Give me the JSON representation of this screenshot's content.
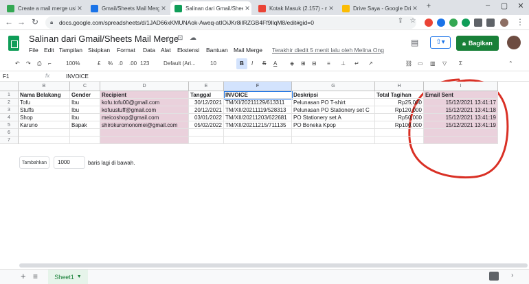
{
  "browser": {
    "tabs": [
      {
        "title": "Create a mail merge using",
        "color": "#34a853"
      },
      {
        "title": "Gmail/Sheets Mail Merge",
        "color": "#1a73e8"
      },
      {
        "title": "Salinan dari Gmail/Sheets",
        "color": "#0f9d58"
      },
      {
        "title": "Kotak Masuk (2.157) - me",
        "color": "#ea4335"
      },
      {
        "title": "Drive Saya - Google Drive",
        "color": "#fbbc04"
      }
    ],
    "new_tab": "+",
    "url": "docs.google.com/spreadsheets/d/1JAD66xKMUNAok-Aweq-atIOiJKr8iIRZGB4Ff9IlqM8/edit#gid=0"
  },
  "sheet": {
    "title": "Salinan dari Gmail/Sheets Mail Merge",
    "menus": [
      "File",
      "Edit",
      "Tampilan",
      "Sisipkan",
      "Format",
      "Data",
      "Alat",
      "Ekstensi",
      "Bantuan",
      "Mail Merge"
    ],
    "last_edit": "Terakhir diedit 5 menit lalu oleh Melina Ong",
    "share_label": "Bagikan",
    "share_color": "#188038"
  },
  "toolbar": {
    "zoom": "100%",
    "currency": "£",
    "percent": "%",
    "decimal_down": ".0",
    "decimal_up": ".00",
    "more_formats": "123",
    "font": "Default (Ari...",
    "font_size": "10",
    "bold": "B",
    "italic": "I",
    "strike": "S",
    "text_color": "A"
  },
  "formula_bar": {
    "cell_ref": "F1",
    "fx": "fx",
    "value": "INVOICE"
  },
  "columns": [
    "B",
    "C",
    "D",
    "E",
    "F",
    "G",
    "H",
    "I"
  ],
  "rows": [
    "1",
    "2",
    "3",
    "4",
    "5",
    "6",
    "7"
  ],
  "headers": [
    "Nama Belakang",
    "Gender",
    "Recipient",
    "Tanggal",
    "INVOICE",
    "Deskripsi",
    "Total Tagihan",
    "Email Sent"
  ],
  "data": [
    [
      "Tofu",
      "Ibu",
      "kofu.tofu00@gmail.com",
      "30/12/2021",
      "TM/XI/20211129/613311",
      "Pelunasan PO T-shirt",
      "Rp25,000",
      "15/12/2021 13:41:17"
    ],
    [
      "Stuffs",
      "Ibu",
      "kofuustuff@gmail.com",
      "20/12/2021",
      "TM/XII/20211119/528313",
      "Pelunasan PO Stationery set C",
      "Rp120,000",
      "15/12/2021 13:41:18"
    ],
    [
      "Shop",
      "Ibu",
      "meicoshop@gmail.com",
      "03/01/2022",
      "TM/XII/20211203/622681",
      "PO Stationery set A",
      "Rp50,000",
      "15/12/2021 13:41:19"
    ],
    [
      "Karuno",
      "Bapak",
      "shirokuromonomei@gmail.com",
      "05/02/2022",
      "TM/XII/20211215/711135",
      "PO Boneka Kpop",
      "Rp100,000",
      "15/12/2021 13:41:19"
    ]
  ],
  "add_rows": {
    "button": "Tambahkan",
    "count": "1000",
    "suffix": "baris lagi di bawah."
  },
  "bottom": {
    "add_sheet": "+",
    "sheet_list": "≡",
    "sheet_tab": "Sheet1"
  },
  "colors": {
    "pink": "#ead1dc",
    "annotation": "#d93025"
  }
}
